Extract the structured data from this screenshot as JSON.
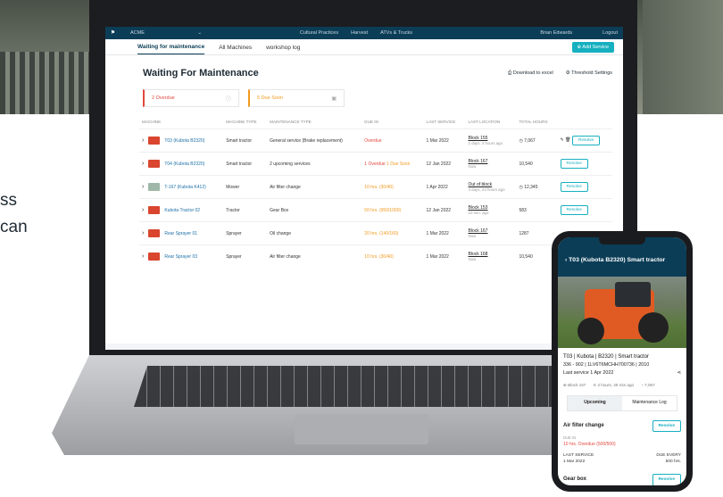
{
  "marketing": {
    "line1": "ss",
    "line2": "can"
  },
  "app": {
    "org": "ACME",
    "nav": [
      "Cultural Practices",
      "Harvest",
      "ATVs & Trucks"
    ],
    "user": "Brian Edwards",
    "logout": "Logout",
    "tabs": [
      "Waiting for maintenance",
      "All Machines",
      "workshop log"
    ],
    "add_service": "Add Service",
    "title": "Waiting For Maintenance",
    "download": "Download to excel",
    "threshold": "Threshold Settings",
    "summary": {
      "overdue": "2 Overdue",
      "due_soon": "5 Due Soon"
    },
    "columns": [
      "MACHINE",
      "MACHINE TYPE",
      "MAINTENANCE TYPE",
      "DUE IN",
      "LAST SERVICE",
      "LAST LOCATION",
      "TOTAL HOURS"
    ],
    "rows": [
      {
        "machine": "T03 (Kubota B2320)",
        "type": "Smart tractor",
        "maint": "General service (Brake replacement)",
        "due": "Overdue",
        "due2": "",
        "last": "1 Mar 2022",
        "loc": "Block 155",
        "loc_sub": "2 days, 4 hours ago",
        "hours": "7,067",
        "resolve": "Resolve"
      },
      {
        "machine": "T04 (Kubota B2320)",
        "type": "Smart tractor",
        "maint": "2 upcoming services",
        "due": "1 Overdue",
        "due2": "1 Due Soon",
        "last": "12 Jan 2022",
        "loc": "Block 167",
        "loc_sub": "Now",
        "hours": "10,540",
        "resolve": "Resolve"
      },
      {
        "machine": "T-167 (Kubota K412)",
        "type": "Mower",
        "maint": "Air filter change",
        "due": "10 hrs. (30/40)",
        "due2": "",
        "last": "1 Apr 2022",
        "loc": "Out of block",
        "loc_sub": "4 days, 23 hours ago",
        "hours": "12,345",
        "resolve": "Resolve"
      },
      {
        "machine": "Kubota Tractor 02",
        "type": "Tractor",
        "maint": "Gear Box",
        "due": "50 hrs. (950/1000)",
        "due2": "",
        "last": "12 Jan 2022",
        "loc": "Block 153",
        "loc_sub": "10 min. ago",
        "hours": "583",
        "resolve": "Resolve"
      },
      {
        "machine": "Rear Sprayer 01",
        "type": "Sprayer",
        "maint": "Oil change",
        "due": "20 hrs. (140/160)",
        "due2": "",
        "last": "1 Mar 2022",
        "loc": "Block 167",
        "loc_sub": "Now",
        "hours": "1287",
        "resolve": ""
      },
      {
        "machine": "Rear Sprayer 03",
        "type": "Sprayer",
        "maint": "Air filter change",
        "due": "10 hrs. (30/40)",
        "due2": "",
        "last": "1 Mar 2022",
        "loc": "Block 168",
        "loc_sub": "Now",
        "hours": "10,540",
        "resolve": ""
      }
    ]
  },
  "phone": {
    "title": "T03 (Kubota B2320) Smart tractor",
    "name": "T03 | Kubota | B2320 | Smart tractor",
    "info": "336 - 902  |  1LV6T6MCHH700736  |  2010",
    "last_service": "Last service  1 Apr 2022",
    "block": "Block 167",
    "time": "2 hours, 25 min ago",
    "hours": "7,067",
    "tabs": [
      "Upcoming",
      "Maintenance Log"
    ],
    "item": "Air filter change",
    "resolve": "Resolve",
    "due_label": "DUE IN",
    "due": "10 hrs. Overdue (500/500)",
    "ls_label": "LAST SERVICE",
    "ls": "1 Mar 2022",
    "due_every_label": "DUE EVERY",
    "due_every": "500 hrs.",
    "next": "Gear box"
  }
}
